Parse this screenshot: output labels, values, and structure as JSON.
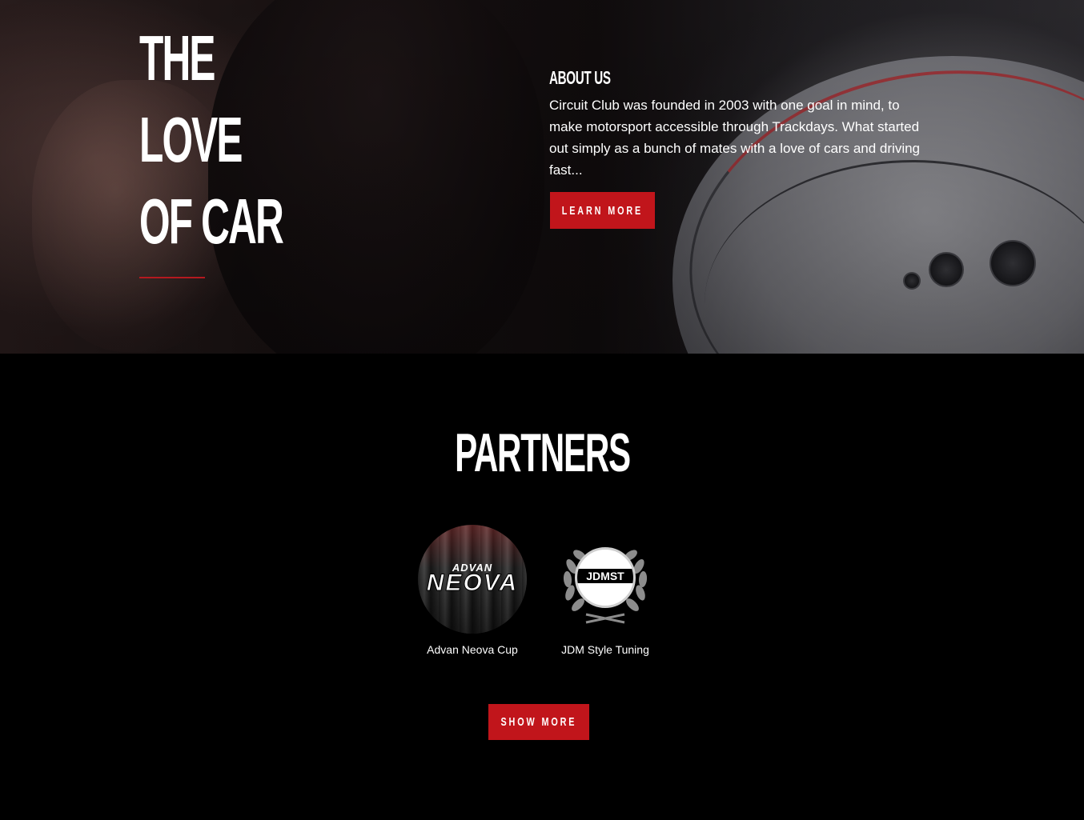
{
  "hero": {
    "title_lines": [
      "THE",
      "LOVE",
      "OF CAR"
    ],
    "accent_color": "#c1151b"
  },
  "about": {
    "heading": "ABOUT US",
    "text": "Circuit Club was founded in 2003 with one goal in mind, to make motorsport accessible through Trackdays. What started out simply as a bunch of mates with a love of cars and driving fast...",
    "button_label": "LEARN MORE"
  },
  "partners": {
    "heading": "PARTNERS",
    "items": [
      {
        "name": "Advan Neova Cup",
        "logo_small": "ADVAN",
        "logo_big": "NEOVA"
      },
      {
        "name": "JDM Style Tuning",
        "logo_text": "JDMST"
      }
    ],
    "button_label": "SHOW MORE"
  }
}
